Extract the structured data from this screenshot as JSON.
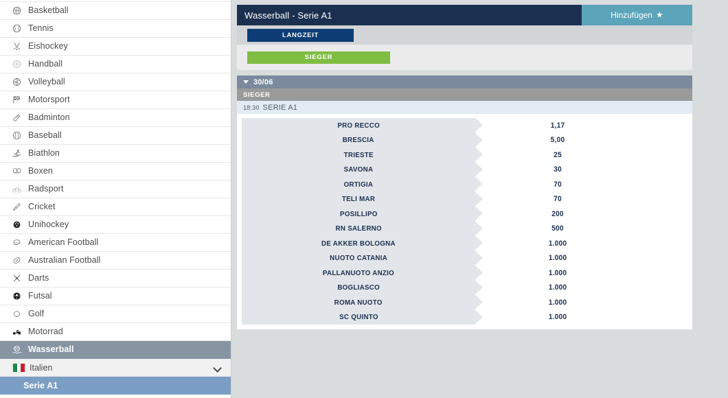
{
  "sidebar": {
    "sports": [
      {
        "label": "Basketball",
        "icon": "basketball-icon"
      },
      {
        "label": "Tennis",
        "icon": "tennis-ball-icon"
      },
      {
        "label": "Eishockey",
        "icon": "ice-hockey-icon"
      },
      {
        "label": "Handball",
        "icon": "handball-icon"
      },
      {
        "label": "Volleyball",
        "icon": "volleyball-icon"
      },
      {
        "label": "Motorsport",
        "icon": "checkered-flag-icon"
      },
      {
        "label": "Badminton",
        "icon": "badminton-shuttlecock-icon"
      },
      {
        "label": "Baseball",
        "icon": "baseball-icon"
      },
      {
        "label": "Biathlon",
        "icon": "biathlon-skier-icon"
      },
      {
        "label": "Boxen",
        "icon": "boxing-gloves-icon"
      },
      {
        "label": "Radsport",
        "icon": "bicycle-icon"
      },
      {
        "label": "Cricket",
        "icon": "cricket-bat-icon"
      },
      {
        "label": "Unihockey",
        "icon": "floorball-icon"
      },
      {
        "label": "American Football",
        "icon": "american-football-helmet-icon"
      },
      {
        "label": "Australian Football",
        "icon": "australian-football-icon"
      },
      {
        "label": "Darts",
        "icon": "darts-icon"
      },
      {
        "label": "Futsal",
        "icon": "futsal-ball-icon"
      },
      {
        "label": "Golf",
        "icon": "golf-ball-icon"
      },
      {
        "label": "Motorrad",
        "icon": "motorbike-icon"
      }
    ],
    "selected_sport": {
      "label": "Wasserball",
      "icon": "waterpolo-icon"
    },
    "country": {
      "label": "Italien",
      "flag": "italy-flag-icon",
      "chevron": "chevron-down-icon"
    },
    "league": {
      "label": "Serie A1"
    }
  },
  "header": {
    "title": "Wasserball - Serie A1",
    "add_label": "Hinzufügen",
    "add_icon": "star-icon"
  },
  "filters": {
    "longterm_label": "LANGZEIT",
    "market_tab_label": "SIEGER"
  },
  "event_group": {
    "date": "30/06",
    "collapse_icon": "triangle-down-icon",
    "market_header": "SIEGER",
    "event_time": "18:30",
    "event_name": "SERIE A1"
  },
  "outcomes": [
    {
      "team": "PRO RECCO",
      "odd": "1,17"
    },
    {
      "team": "BRESCIA",
      "odd": "5,00"
    },
    {
      "team": "TRIESTE",
      "odd": "25"
    },
    {
      "team": "SAVONA",
      "odd": "30"
    },
    {
      "team": "ORTIGIA",
      "odd": "70"
    },
    {
      "team": "TELI MAR",
      "odd": "70"
    },
    {
      "team": "POSILLIPO",
      "odd": "200"
    },
    {
      "team": "RN SALERNO",
      "odd": "500"
    },
    {
      "team": "DE AKKER BOLOGNA",
      "odd": "1.000"
    },
    {
      "team": "NUOTO CATANIA",
      "odd": "1.000"
    },
    {
      "team": "PALLANUOTO ANZIO",
      "odd": "1.000"
    },
    {
      "team": "BOGLIASCO",
      "odd": "1.000"
    },
    {
      "team": "ROMA NUOTO",
      "odd": "1.000"
    },
    {
      "team": "SC QUINTO",
      "odd": "1.000"
    }
  ],
  "colors": {
    "page_bg": "#d9dcdc",
    "header_navy": "#1b3050",
    "add_teal": "#5ba4b9",
    "longterm_navy": "#0d3d74",
    "market_green": "#7fbd42",
    "date_slate": "#7b8a9c",
    "market_gray": "#9a9a9a",
    "event_blue": "#e3ecf4",
    "outcome_gray": "#e2e5e9",
    "sidebar_selected": "#8795a3",
    "league_blue": "#7b9fc4"
  }
}
